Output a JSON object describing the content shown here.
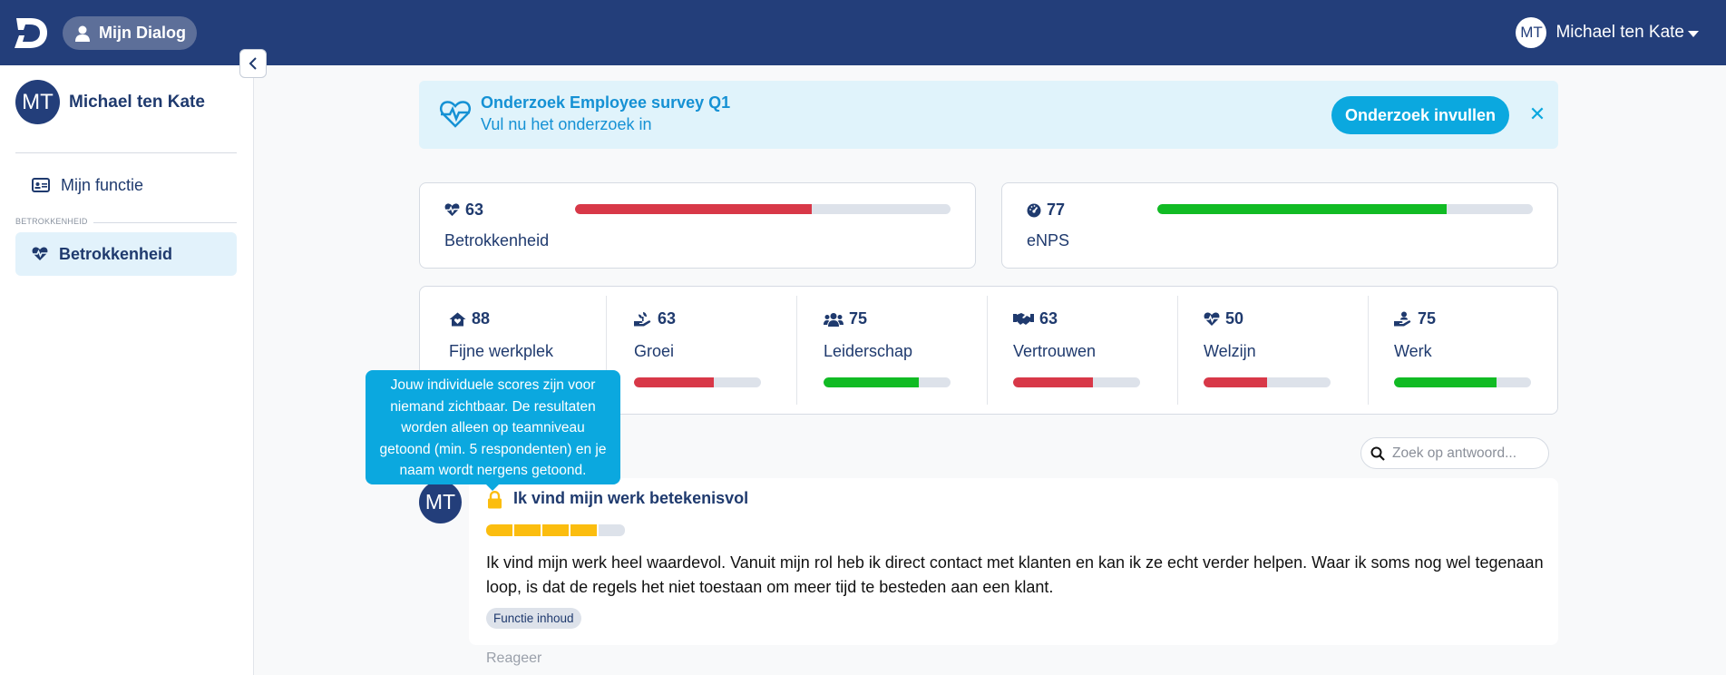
{
  "app": {
    "logo": "D",
    "nav_button_label": "Mijn Dialog",
    "user_initials": "MT",
    "user_name": "Michael ten Kate"
  },
  "sidebar": {
    "profile_initials": "MT",
    "profile_name": "Michael ten Kate",
    "items": [
      {
        "label": "Mijn functie",
        "icon": "id-card-icon"
      },
      {
        "label": "Betrokkenheid",
        "icon": "heart-pulse-icon",
        "active": true
      }
    ],
    "section_label": "BETROKKENHEID"
  },
  "banner": {
    "title": "Onderzoek Employee survey Q1",
    "subtitle": "Vul nu het onderzoek in",
    "button_label": "Onderzoek invullen",
    "close_label": "✕"
  },
  "main_scores": [
    {
      "value": "63",
      "label": "Betrokkenheid",
      "icon": "heart-pulse-icon",
      "progress": 0.63,
      "color": "#d83848"
    },
    {
      "value": "77",
      "label": "eNPS",
      "icon": "gauge-icon",
      "progress": 0.77,
      "color": "#11bb24"
    }
  ],
  "categories": [
    {
      "value": "88",
      "label": "Fijne werkplek",
      "icon": "home-heart-icon",
      "progress": 0.88,
      "color": "#11bb24"
    },
    {
      "value": "63",
      "label": "Groei",
      "icon": "hand-growth-icon",
      "progress": 0.63,
      "color": "#d83848"
    },
    {
      "value": "75",
      "label": "Leiderschap",
      "icon": "users-icon",
      "progress": 0.75,
      "color": "#11bb24"
    },
    {
      "value": "63",
      "label": "Vertrouwen",
      "icon": "handshake-icon",
      "progress": 0.63,
      "color": "#d83848"
    },
    {
      "value": "50",
      "label": "Welzijn",
      "icon": "heart-pulse-icon",
      "progress": 0.5,
      "color": "#d83848"
    },
    {
      "value": "75",
      "label": "Werk",
      "icon": "hand-user-icon",
      "progress": 0.75,
      "color": "#11bb24"
    }
  ],
  "tooltip": {
    "text": "Jouw individuele scores zijn voor niemand zichtbaar. De resultaten worden alleen op teamniveau getoond (min. 5 respondenten) en je naam wordt nergens getoond."
  },
  "search": {
    "placeholder": "Zoek op antwoord..."
  },
  "answer": {
    "initials": "MT",
    "question": "Ik vind mijn werk betekenisvol",
    "rating": 4,
    "rating_max": 5,
    "text": "Ik vind mijn werk heel waardevol. Vanuit mijn rol heb ik direct contact met klanten en kan ik ze echt verder helpen. Waar ik soms nog wel tegenaan loop, is dat de regels het niet toestaan om meer tijd te besteden aan een klant.",
    "tag": "Functie inhoud",
    "reply_label": "Reageer"
  },
  "colors": {
    "navbar": "#233e7a",
    "accent": "#0ba8df",
    "bad": "#d83848",
    "good": "#11bb24",
    "star": "#fbbd0f"
  }
}
